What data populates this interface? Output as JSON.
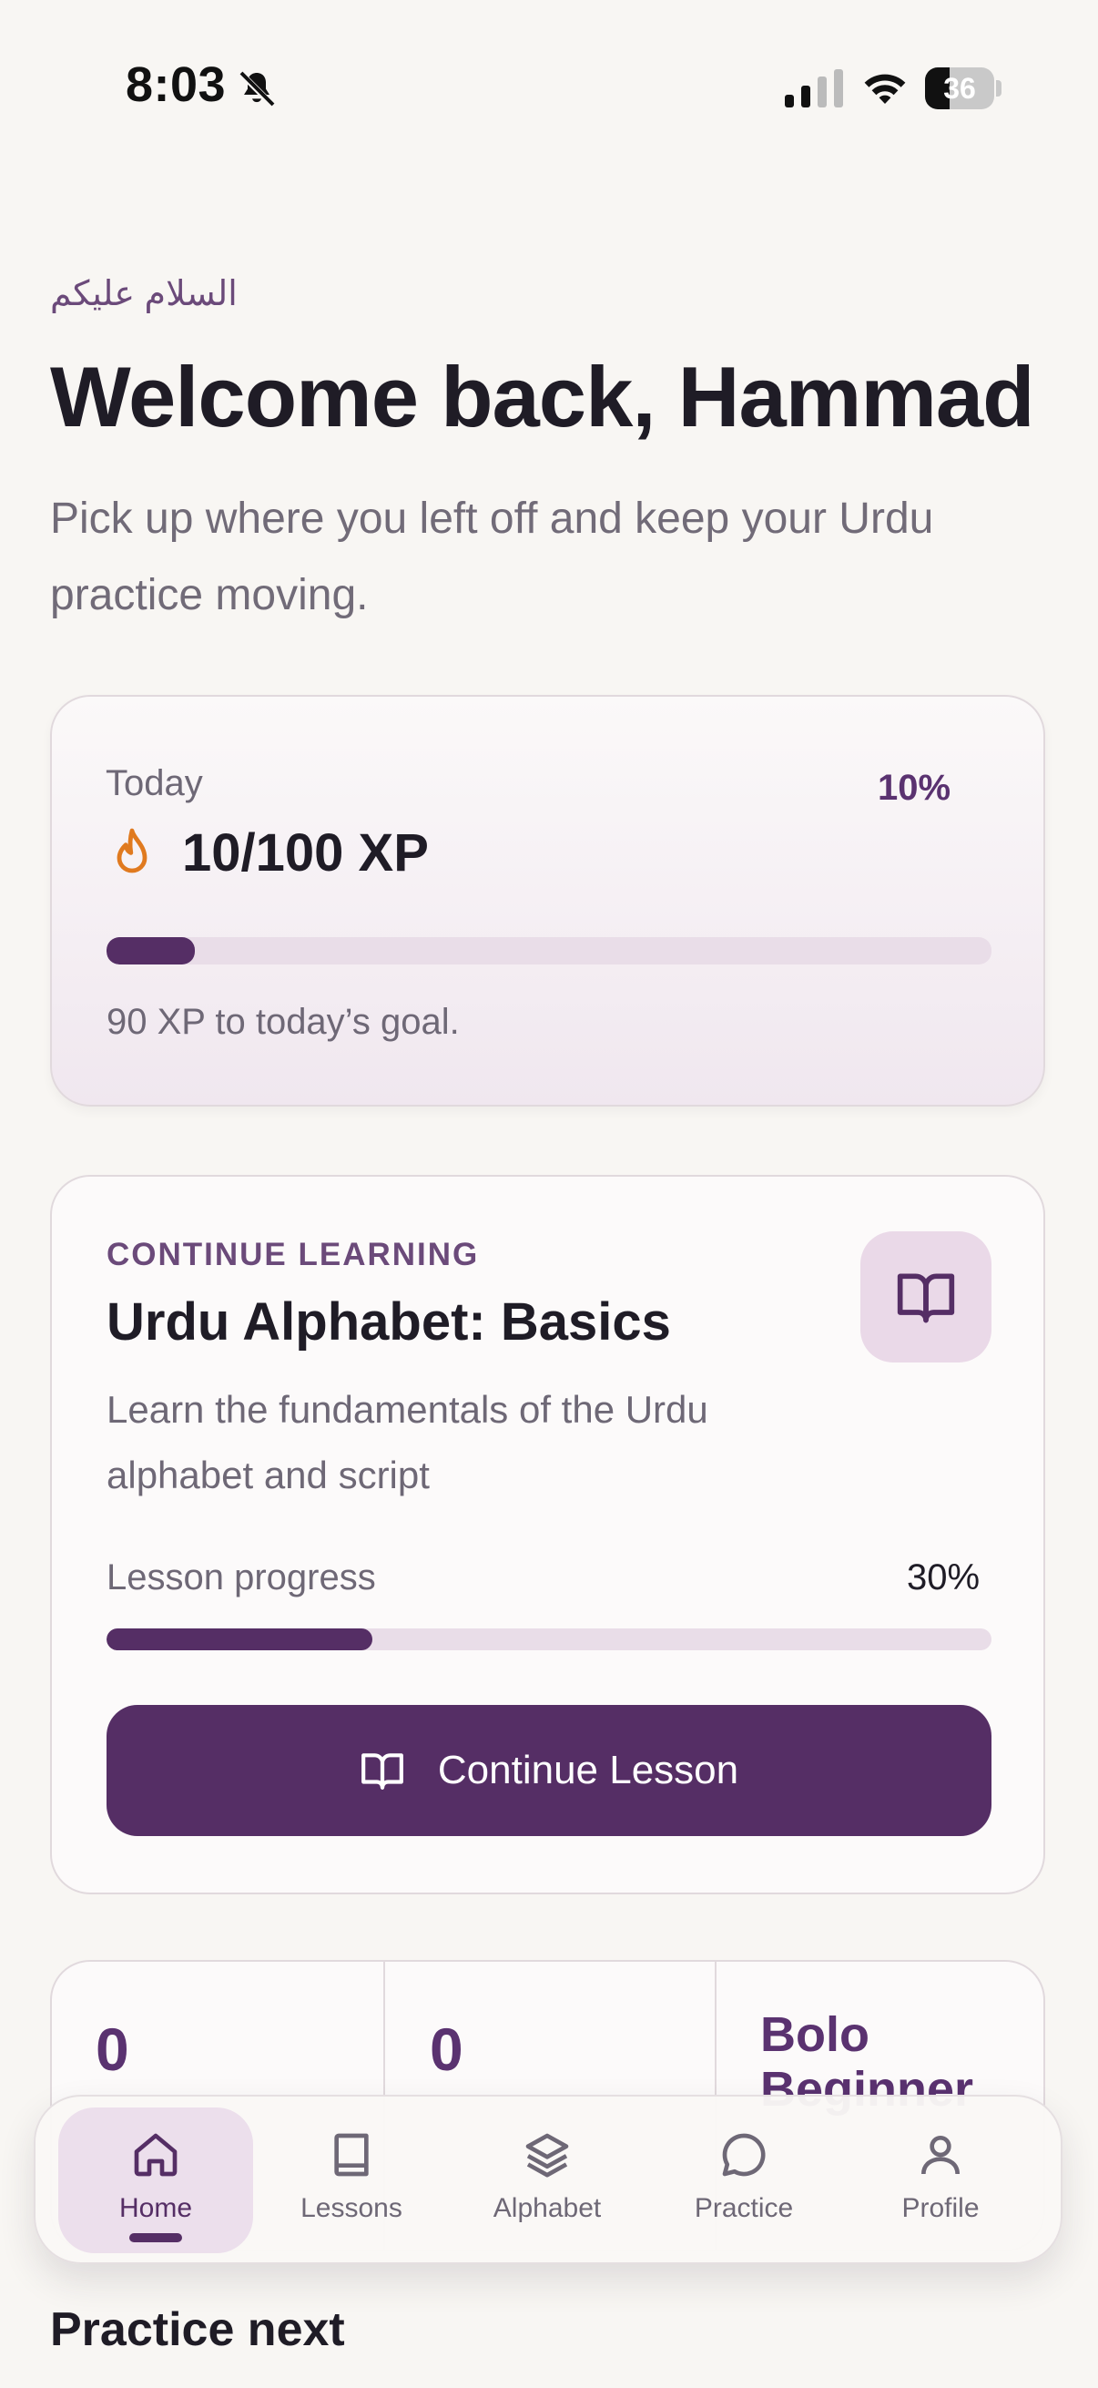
{
  "status_bar": {
    "time": "8:03",
    "battery": "36"
  },
  "header": {
    "greeting": "السلام علیکم",
    "title": "Welcome back, Hammad",
    "subtitle": "Pick up where you left off and keep your Urdu practice moving."
  },
  "today": {
    "label": "Today",
    "percent_label": "10%",
    "xp": "10/100 XP",
    "progress": 0.1,
    "note": "90 XP to today’s goal."
  },
  "continue_learning": {
    "section_label": "CONTINUE LEARNING",
    "title": "Urdu Alphabet: Basics",
    "description": "Learn the fundamentals of the Urdu alphabet and script",
    "progress_label": "Lesson progress",
    "progress_value": "30%",
    "progress": 0.3,
    "button_label": "Continue Lesson"
  },
  "stats": [
    {
      "value": "0"
    },
    {
      "value": "0"
    },
    {
      "value": "Bolo Beginner"
    }
  ],
  "nav": {
    "tabs": [
      {
        "label": "Home",
        "icon": "home-icon",
        "active": true
      },
      {
        "label": "Lessons",
        "icon": "book-icon",
        "active": false
      },
      {
        "label": "Alphabet",
        "icon": "layers-icon",
        "active": false
      },
      {
        "label": "Practice",
        "icon": "chat-bubble-icon",
        "active": false
      },
      {
        "label": "Profile",
        "icon": "user-icon",
        "active": false
      }
    ]
  },
  "practice_next": {
    "title": "Practice next"
  },
  "colors": {
    "accent": "#552e65",
    "accent_light": "#ecdfec",
    "flame": "#e07a1f",
    "background": "#f8f6f3"
  }
}
